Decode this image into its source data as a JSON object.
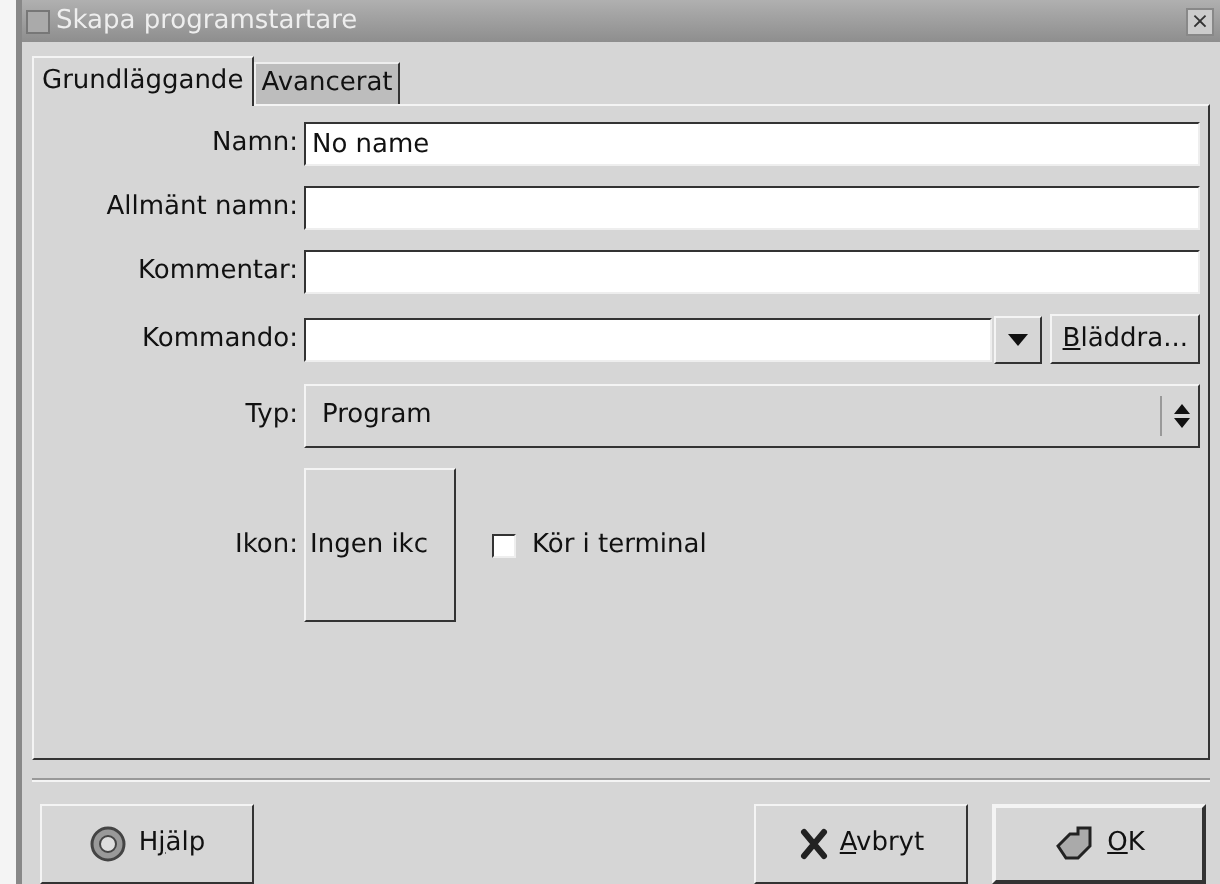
{
  "window": {
    "title": "Skapa programstartare",
    "close": "×"
  },
  "tabs": [
    {
      "label": "Grundläggande",
      "selected": true
    },
    {
      "label": "Avancerat",
      "selected": false
    }
  ],
  "fields": [
    {
      "label": "Namn:",
      "value": "No name"
    },
    {
      "label": "Allmänt namn:"
    },
    {
      "label": "Kommentar:"
    }
  ],
  "command": {
    "label": "Kommando:",
    "browse": {
      "key": "B",
      "post": "läddra..."
    }
  },
  "type": {
    "label": "Typ:",
    "value": "Program"
  },
  "icon": {
    "label": "Ikon:",
    "button": "Ingen ikc"
  },
  "terminal": {
    "label": "Kör i terminal",
    "checked": false
  },
  "buttons": [
    {
      "kind": "help",
      "pre": "H",
      "key": "j",
      "post": "älp"
    },
    {
      "kind": "cancel",
      "key": "A",
      "post": "vbryt"
    },
    {
      "kind": "ok",
      "key": "O",
      "post": "K"
    }
  ]
}
